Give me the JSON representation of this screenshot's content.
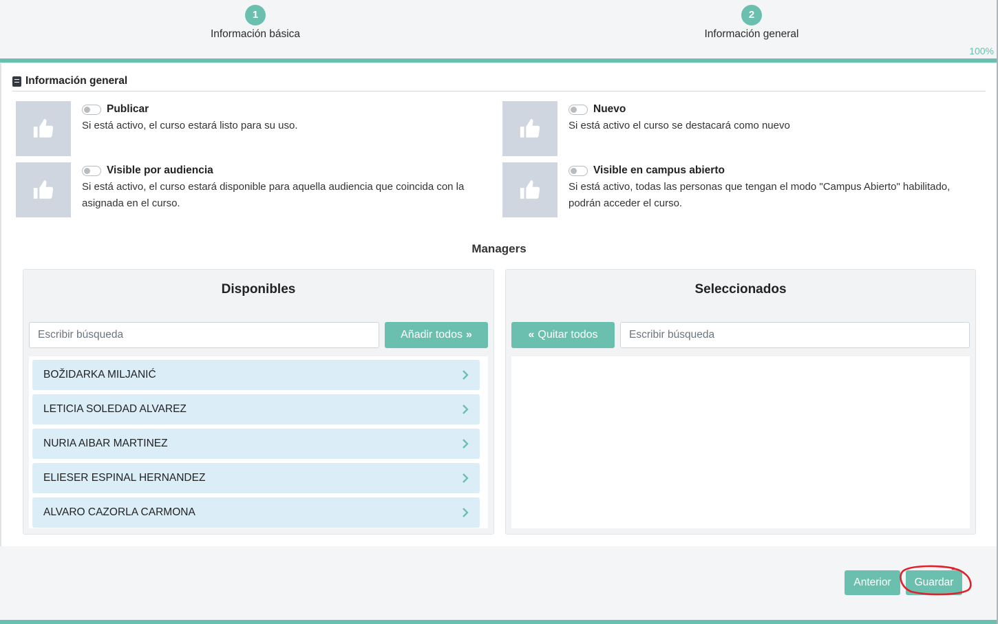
{
  "stepper": {
    "steps": [
      {
        "number": "1",
        "label": "Información básica"
      },
      {
        "number": "2",
        "label": "Información general"
      }
    ],
    "progress_text": "100%",
    "progress": 1.0
  },
  "section": {
    "title": "Información general",
    "icon": "book-icon"
  },
  "options": [
    {
      "title": "Publicar",
      "description": "Si está activo, el curso estará listo para su uso.",
      "enabled": false,
      "icon": "thumbs-up-icon"
    },
    {
      "title": "Nuevo",
      "description": "Si está activo el curso se destacará como nuevo",
      "enabled": false,
      "icon": "thumbs-up-icon"
    },
    {
      "title": "Visible por audiencia",
      "description": "Si está activo, el curso estará disponible para aquella audiencia que coincida con la asignada en el curso.",
      "enabled": false,
      "icon": "thumbs-up-icon"
    },
    {
      "title": "Visible en campus abierto",
      "description": "Si está activo, todas las personas que tengan el modo \"Campus Abierto\" habilitado, podrán acceder el curso.",
      "enabled": false,
      "icon": "thumbs-up-icon"
    }
  ],
  "managers": {
    "title": "Managers",
    "available": {
      "title": "Disponibles",
      "search_placeholder": "Escribir búsqueda",
      "add_all_label": "Añadir todos",
      "items": [
        "BOŽIDARKA MILJANIĆ",
        "LETICIA SOLEDAD ALVAREZ",
        "NURIA AIBAR MARTINEZ",
        "ELIESER ESPINAL HERNANDEZ",
        "ALVARO CAZORLA CARMONA"
      ]
    },
    "selected": {
      "title": "Seleccionados",
      "search_placeholder": "Escribir búsqueda",
      "remove_all_label": "Quitar todos",
      "items": []
    }
  },
  "footer": {
    "prev_label": "Anterior",
    "save_label": "Guardar"
  },
  "colors": {
    "accent": "#6bbfae",
    "list_item_bg": "#dbeef8",
    "tile_bg": "#cfd6df",
    "annotation": "#e0202a"
  }
}
